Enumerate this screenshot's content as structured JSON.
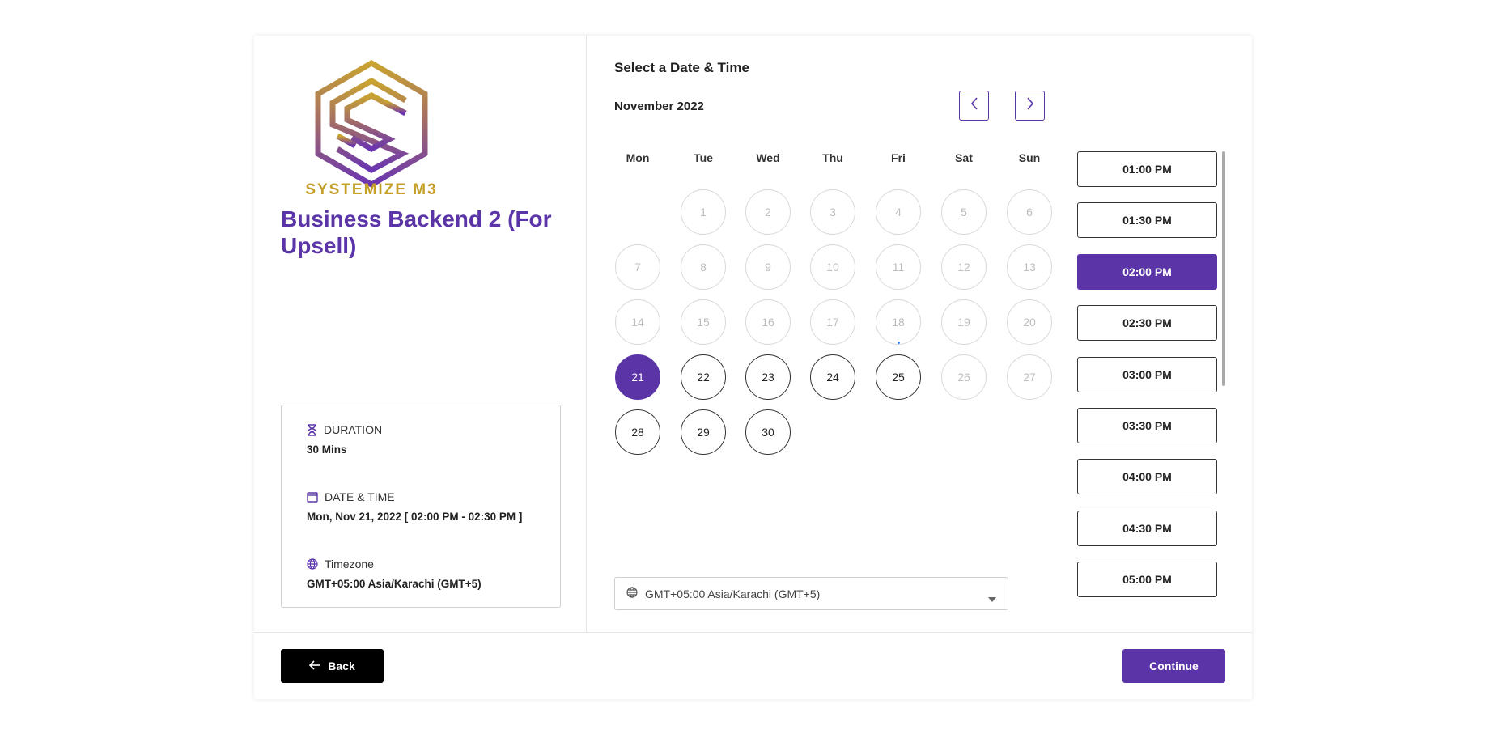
{
  "brand": {
    "name": "SYSTEMIZE M3",
    "logo_icon": "hexagon-s-logo",
    "gold": "#c4a028",
    "purple": "#5b35a8"
  },
  "event": {
    "title": "Business Backend 2 (For Upsell)"
  },
  "info": {
    "duration": {
      "label": "DURATION",
      "value": "30 Mins",
      "icon": "hourglass-icon"
    },
    "datetime": {
      "label": "DATE & TIME",
      "value": "Mon, Nov 21, 2022 [ 02:00 PM - 02:30 PM ]",
      "icon": "calendar-icon"
    },
    "timezone": {
      "label": "Timezone",
      "value": "GMT+05:00 Asia/Karachi (GMT+5)",
      "icon": "globe-icon"
    }
  },
  "calendar": {
    "title": "Select a Date & Time",
    "month": "November 2022",
    "weekdays": [
      "Mon",
      "Tue",
      "Wed",
      "Thu",
      "Fri",
      "Sat",
      "Sun"
    ],
    "first_weekday_index": 1,
    "days_in_month": 30,
    "available_days": [
      22,
      23,
      24,
      25,
      28,
      29,
      30
    ],
    "selected_day": 21,
    "today": 18
  },
  "time_slots": [
    "01:00 PM",
    "01:30 PM",
    "02:00 PM",
    "02:30 PM",
    "03:00 PM",
    "03:30 PM",
    "04:00 PM",
    "04:30 PM",
    "05:00 PM"
  ],
  "selected_slot": "02:00 PM",
  "timezone_select": {
    "value": "GMT+05:00 Asia/Karachi (GMT+5)"
  },
  "footer": {
    "back_label": "Back",
    "continue_label": "Continue"
  }
}
